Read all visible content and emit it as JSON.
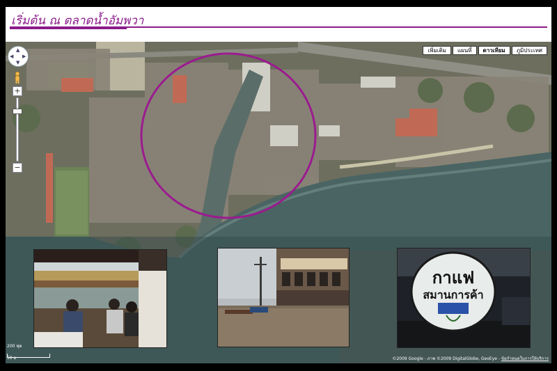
{
  "header": {
    "title": "เริ่มต้น ณ ตลาดน้ำอัมพวา"
  },
  "map": {
    "types": [
      {
        "label": "เพิ่มเติม",
        "active": false
      },
      {
        "label": "แผนที่",
        "active": false
      },
      {
        "label": "ดาวเทียม",
        "active": true
      },
      {
        "label": "ภูมิประเทศ",
        "active": false
      }
    ],
    "zoom": {
      "plus": "+",
      "minus": "−"
    },
    "scale": {
      "metric": "200 ฟุต",
      "imperial": "50 ม"
    },
    "copyright": "©2009 Google - ภาพ ©2009 DigitalGlobe, GeoEye -",
    "terms": "ข้อกำหนดในการให้บริการ",
    "highlight_color": "#9b1b8f"
  },
  "photos": {
    "sign": {
      "line1": "กาแฟ",
      "line2": "สมานการค้า"
    }
  }
}
